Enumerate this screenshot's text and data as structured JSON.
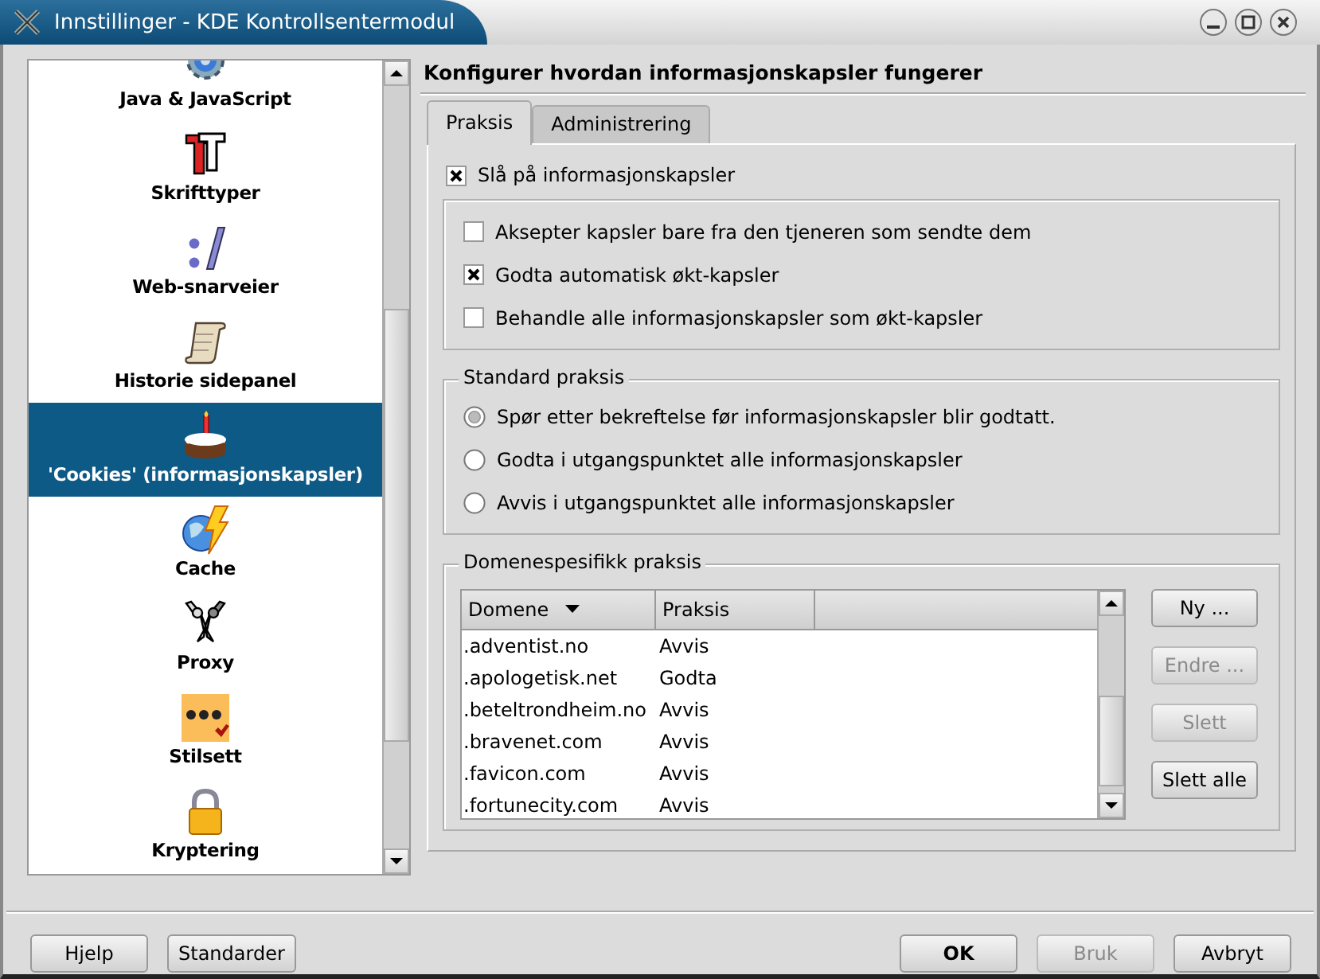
{
  "window": {
    "title": "Innstillinger - KDE Kontrollsentermodul"
  },
  "sidebar": {
    "items": [
      {
        "label": "Java & JavaScript",
        "selected": false
      },
      {
        "label": "Skrifttyper",
        "selected": false
      },
      {
        "label": "Web-snarveier",
        "selected": false
      },
      {
        "label": "Historie sidepanel",
        "selected": false
      },
      {
        "label": "'Cookies' (informasjonskapsler)",
        "selected": true
      },
      {
        "label": "Cache",
        "selected": false
      },
      {
        "label": "Proxy",
        "selected": false
      },
      {
        "label": "Stilsett",
        "selected": false
      },
      {
        "label": "Kryptering",
        "selected": false
      }
    ]
  },
  "heading": "Konfigurer hvordan informasjonskapsler fungerer",
  "tabs": [
    {
      "label": "Praksis",
      "selected": true
    },
    {
      "label": "Administrering",
      "selected": false
    }
  ],
  "enable": {
    "label": "Slå på informasjonskapsler",
    "checked": true
  },
  "options": [
    {
      "label": "Aksepter kapsler bare fra den tjeneren som sendte dem",
      "checked": false
    },
    {
      "label": "Godta automatisk økt-kapsler",
      "checked": true
    },
    {
      "label": "Behandle alle informasjonskapsler som økt-kapsler",
      "checked": false
    }
  ],
  "standard_policy": {
    "title": "Standard praksis",
    "options": [
      {
        "label": "Spør etter bekreftelse før informasjonskapsler blir godtatt.",
        "selected": true
      },
      {
        "label": "Godta i utgangspunktet alle informasjonskapsler",
        "selected": false
      },
      {
        "label": "Avvis i utgangspunktet alle informasjonskapsler",
        "selected": false
      }
    ]
  },
  "domain_policy": {
    "title": "Domenespesifikk praksis",
    "columns": [
      {
        "label": "Domene",
        "sorted": true
      },
      {
        "label": "Praksis",
        "sorted": false
      }
    ],
    "rows": [
      [
        ".adventist.no",
        "Avvis"
      ],
      [
        ".apologetisk.net",
        "Godta"
      ],
      [
        ".beteltrondheim.no",
        "Avvis"
      ],
      [
        ".bravenet.com",
        "Avvis"
      ],
      [
        ".favicon.com",
        "Avvis"
      ],
      [
        ".fortunecity.com",
        "Avvis"
      ]
    ],
    "buttons": [
      {
        "label": "Ny ...",
        "disabled": false
      },
      {
        "label": "Endre ...",
        "disabled": true
      },
      {
        "label": "Slett",
        "disabled": true
      },
      {
        "label": "Slett alle",
        "disabled": false
      }
    ]
  },
  "footer": {
    "left_buttons": [
      {
        "label": "Hjelp",
        "disabled": false,
        "default": false
      },
      {
        "label": "Standarder",
        "disabled": false,
        "default": false
      }
    ],
    "right_buttons": [
      {
        "label": "OK",
        "disabled": false,
        "default": true
      },
      {
        "label": "Bruk",
        "disabled": true,
        "default": false
      },
      {
        "label": "Avbryt",
        "disabled": false,
        "default": false
      }
    ]
  }
}
